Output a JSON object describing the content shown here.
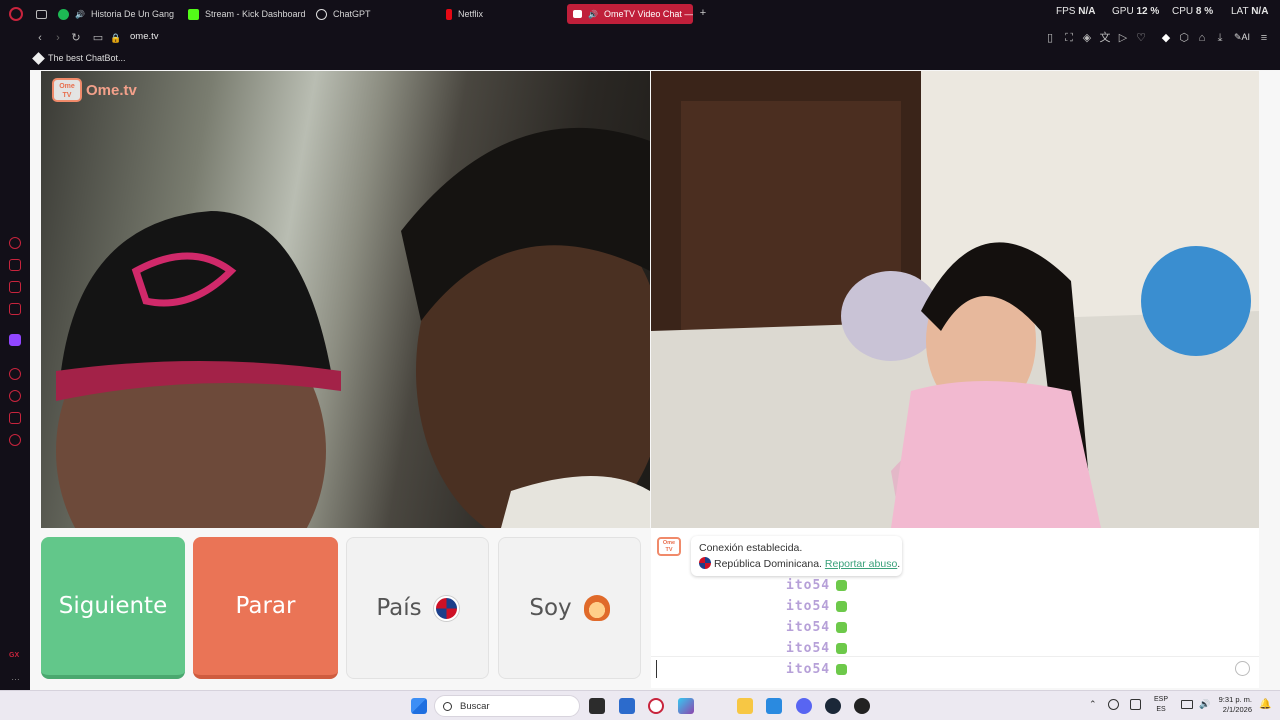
{
  "browser": {
    "tabs": [
      {
        "label": "Historia De Un Gangst",
        "color": "#1db954"
      },
      {
        "label": "Stream - Kick Dashboard",
        "color": "#53fc18"
      },
      {
        "label": "ChatGPT",
        "color": "#d0d0d0"
      },
      {
        "label": "Netflix",
        "color": "#e50914"
      },
      {
        "label": "OmeTV Video Chat —",
        "color": "#ffffff"
      }
    ],
    "new_tab": "+",
    "hud": {
      "fps_label": "FPS",
      "fps_value": "N/A",
      "gpu_label": "GPU",
      "gpu_value": "12 %",
      "cpu_label": "CPU",
      "cpu_value": "8 %",
      "lat_label": "LAT",
      "lat_value": "N/A"
    },
    "address": "ome.tv",
    "ai_label": "AI",
    "bookmark": "The best ChatBot..."
  },
  "sidebar_bottom": "GX",
  "site": {
    "logo_text": "Ome.tv",
    "logo_badge": "Ome TV",
    "buttons": {
      "next": "Siguiente",
      "stop": "Parar",
      "country": "País",
      "country_flag": "🇩🇴",
      "me": "Soy",
      "me_emoji": "👩"
    },
    "chat": {
      "status": "Conexión establecida.",
      "country": "República Dominicana.",
      "report_link": "Reportar abuso",
      "report_suffix": ".",
      "repeated_messages": [
        "ito54",
        "ito54",
        "ito54",
        "ito54",
        "ito54"
      ],
      "input_placeholder": ""
    }
  },
  "taskbar": {
    "search_placeholder": "Buscar",
    "lang_top": "ESP",
    "lang_bottom": "ES",
    "time": "9:31 p. m.",
    "date": "2/1/2026"
  },
  "colors": {
    "accent": "#c01f3a",
    "next_btn": "#62c78a",
    "stop_btn": "#ea7456",
    "link": "#3aa17a"
  }
}
